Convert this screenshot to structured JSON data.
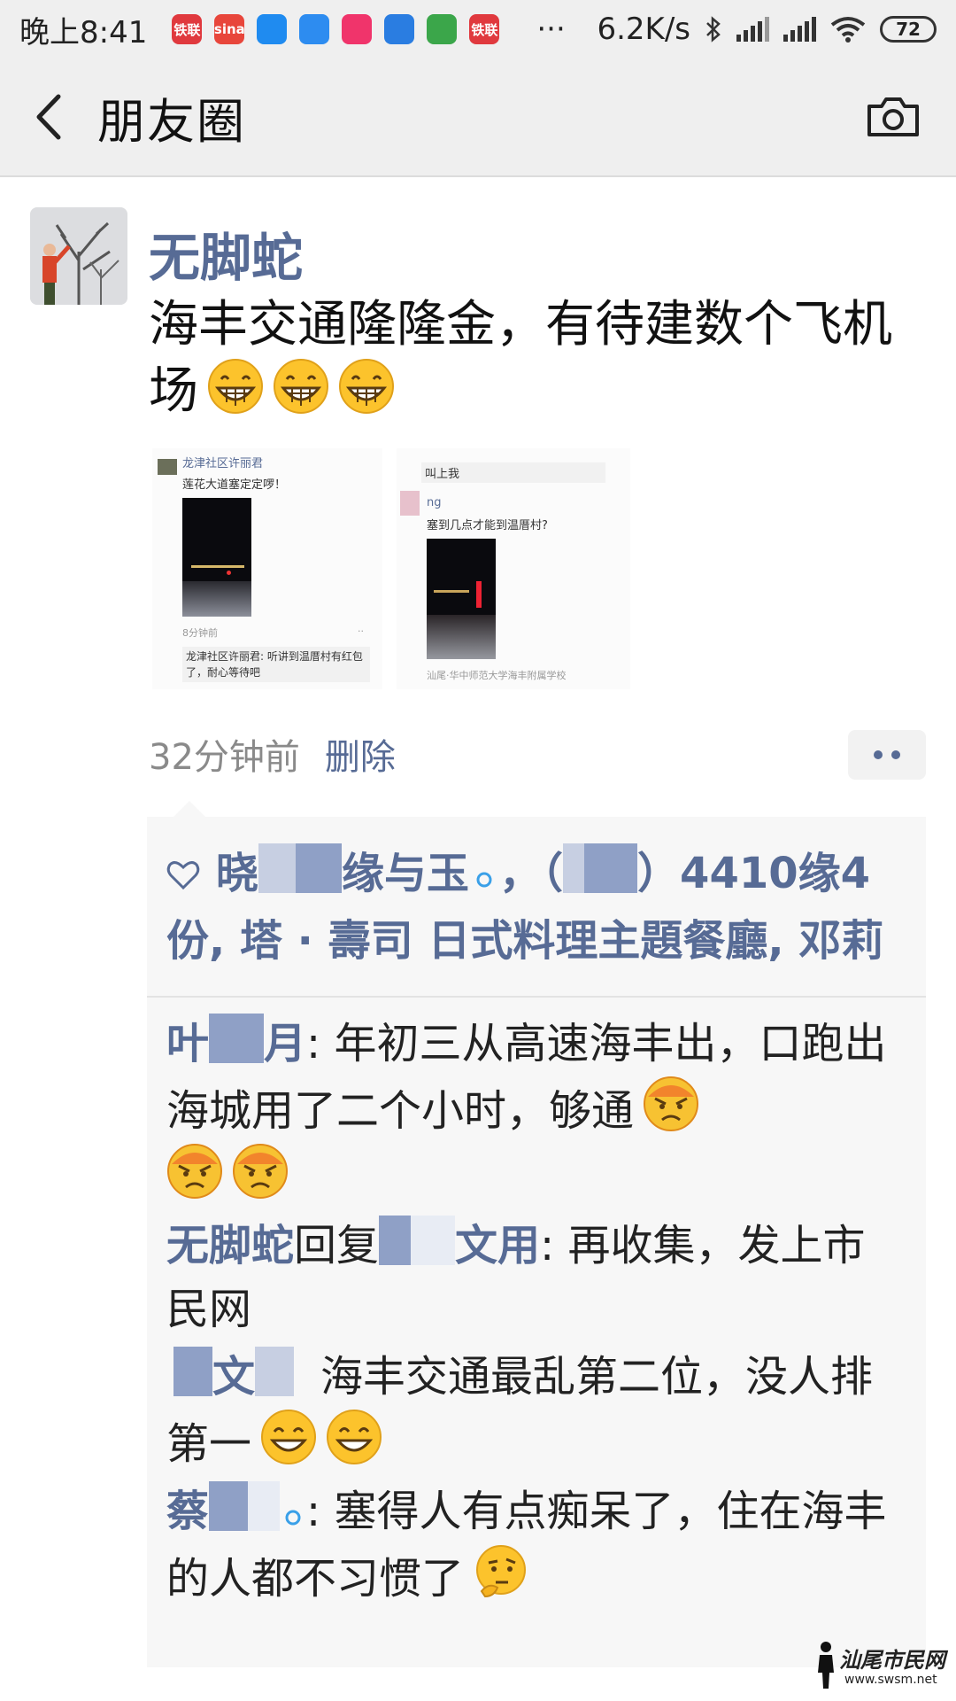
{
  "status_bar": {
    "time": "晚上8:41",
    "notifications": [
      {
        "label": "铁联",
        "color": "#e0393e"
      },
      {
        "label": "sina",
        "color": "#e8463b"
      },
      {
        "label": "",
        "color": "#1f8bf0"
      },
      {
        "label": "",
        "color": "#2d8cf0"
      },
      {
        "label": "",
        "color": "#f0346b"
      },
      {
        "label": "",
        "color": "#2a7de1"
      },
      {
        "label": "",
        "color": "#3ba64a"
      },
      {
        "label": "铁联",
        "color": "#e0393e"
      }
    ],
    "more": "···",
    "speed": "6.2K/s",
    "battery": "72"
  },
  "header": {
    "title": "朋友圈"
  },
  "post": {
    "author": "无脚蛇",
    "text": "海丰交通隆隆金，有待建数个飞机场",
    "time": "32分钟前",
    "delete_label": "删除",
    "embedded": {
      "left": {
        "name": "龙津社区许丽君",
        "text": "莲花大道塞定定啰！",
        "time": "8分钟前",
        "comment": "龙津社区许丽君: 听讲到温厝村有红包了，耐心等待吧"
      },
      "right": {
        "header": "叫上我",
        "name": "ng",
        "text": "塞到几点才能到温厝村?",
        "location": "汕尾·华中师范大学海丰附属学校"
      }
    }
  },
  "likes": {
    "parts": [
      "晓",
      "缘与玉",
      "，（",
      "）4410缘4份, 塔 · 壽司 日式料理主題餐廳, 邓莉"
    ]
  },
  "comments": [
    {
      "name_a": "叶",
      "name_b": "月",
      "separator": ": ",
      "text": "年初三从高速海丰出，口跑出海城用了二个小时，够通"
    },
    {
      "name_a": "无脚蛇",
      "reply": "回复",
      "name_b": "文用",
      "separator": ": ",
      "text": "再收集，发上市民网"
    },
    {
      "name_a": "文",
      "separator": "",
      "text": "海丰交通最乱第二位，没人排第一"
    },
    {
      "name_a": "蔡",
      "separator": ": ",
      "text": "塞得人有点痴呆了，住在海丰的人都不习惯了"
    }
  ],
  "watermark": {
    "text": "汕尾市民网",
    "url": "www.swsm.net"
  },
  "colors": {
    "link": "#576b95",
    "bar_bg": "#efefef",
    "comment_bg": "#f7f7f7"
  },
  "icons": [
    "back-arrow-icon",
    "camera-icon",
    "heart-icon",
    "grin-emoji-icon",
    "angry-emoji-icon",
    "smile-emoji-icon",
    "thinking-emoji-icon",
    "bluetooth-icon",
    "wifi-icon",
    "signal-icon",
    "battery-icon"
  ]
}
